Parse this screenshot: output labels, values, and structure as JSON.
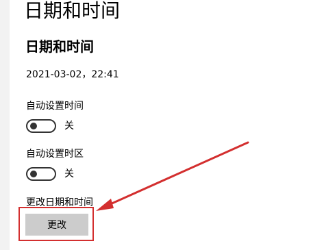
{
  "header": {
    "page_title": "日期和时间"
  },
  "section": {
    "title": "日期和时间",
    "current_datetime": "2021-03-02，22:41"
  },
  "settings": {
    "auto_time": {
      "label": "自动设置时间",
      "state": "关",
      "on": false
    },
    "auto_timezone": {
      "label": "自动设置时区",
      "state": "关",
      "on": false
    },
    "change_datetime": {
      "label": "更改日期和时间",
      "button_label": "更改"
    }
  },
  "annotation": {
    "highlight_color": "#d32f2f"
  },
  "icons": {
    "toggle_knob": "toggle-knob-icon",
    "arrow": "red-arrow-icon"
  }
}
